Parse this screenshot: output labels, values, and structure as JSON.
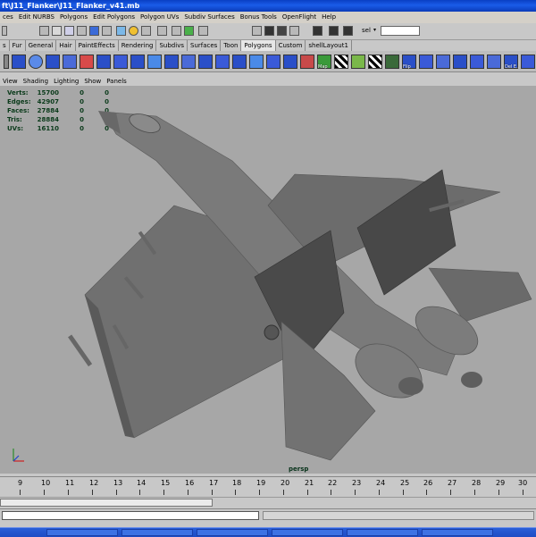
{
  "window": {
    "title": "ft\\J11_Flanker\\J11_Flanker_v41.mb"
  },
  "menubar": {
    "items": [
      "ces",
      "Edit NURBS",
      "Polygons",
      "Edit Polygons",
      "Polygon UVs",
      "Subdiv Surfaces",
      "Bonus Tools",
      "OpenFlight",
      "Help"
    ]
  },
  "statusline": {
    "sel_label": "sel",
    "sel_value": ""
  },
  "shelf_tabs": {
    "items": [
      "s",
      "Fur",
      "General",
      "Hair",
      "PaintEffects",
      "Rendering",
      "Subdivs",
      "Surfaces",
      "Toon",
      "Polygons",
      "Custom",
      "shellLayout1"
    ],
    "active": "Polygons"
  },
  "shelf": {
    "icon_labels": [
      "Map",
      "Flip",
      "Del E..."
    ]
  },
  "panel_menu": {
    "items": [
      "View",
      "Shading",
      "Lighting",
      "Show",
      "Panels"
    ]
  },
  "hud": {
    "rows": [
      {
        "label": "Verts:",
        "value": "15700",
        "sel": "0",
        "sel2": "0"
      },
      {
        "label": "Edges:",
        "value": "42907",
        "sel": "0",
        "sel2": "0"
      },
      {
        "label": "Faces:",
        "value": "27884",
        "sel": "0",
        "sel2": "0"
      },
      {
        "label": "Tris:",
        "value": "28884",
        "sel": "0",
        "sel2": "0"
      },
      {
        "label": "UVs:",
        "value": "16110",
        "sel": "0",
        "sel2": "0"
      }
    ]
  },
  "viewport": {
    "camera": "persp",
    "background": "#a7a7a7",
    "model_color": "#6e6e6e"
  },
  "timeline": {
    "ticks": [
      "9",
      "10",
      "11",
      "12",
      "13",
      "14",
      "15",
      "16",
      "17",
      "18",
      "19",
      "20",
      "21",
      "22",
      "23",
      "24",
      "25",
      "26",
      "27",
      "28",
      "29",
      "30"
    ]
  },
  "range_slider": {
    "value": ""
  },
  "command_line": {
    "value": "",
    "result": ""
  }
}
